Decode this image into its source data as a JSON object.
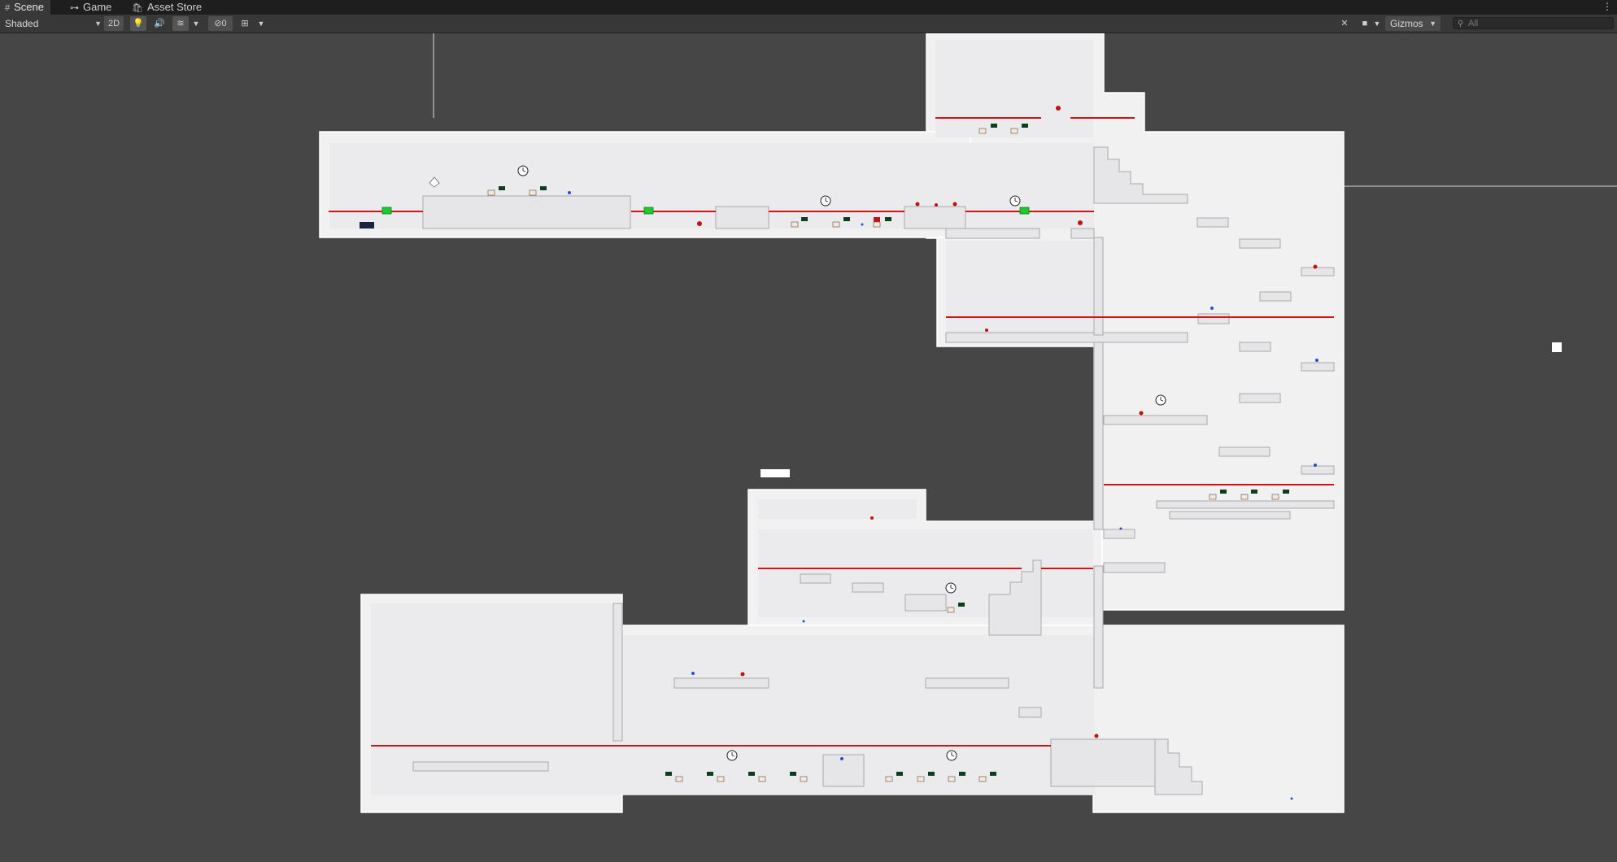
{
  "tabs": [
    {
      "label": "Scene",
      "icon": "scene-grid-icon",
      "active": true
    },
    {
      "label": "Game",
      "icon": "gamepad-icon",
      "active": false
    },
    {
      "label": "Asset Store",
      "icon": "store-bag-icon",
      "active": false
    }
  ],
  "toolbar": {
    "draw_mode": "Shaded",
    "btn_2d": "2D",
    "hidden_count": "0",
    "gizmos_label": "Gizmos",
    "search_placeholder": "All"
  },
  "colors": {
    "background": "#464646",
    "toolbar": "#383838",
    "tabbar": "#1e1e1e",
    "level_fill": "#f1f1f2",
    "laser": "#d01414",
    "checkpoint": "#1ccc2e"
  }
}
